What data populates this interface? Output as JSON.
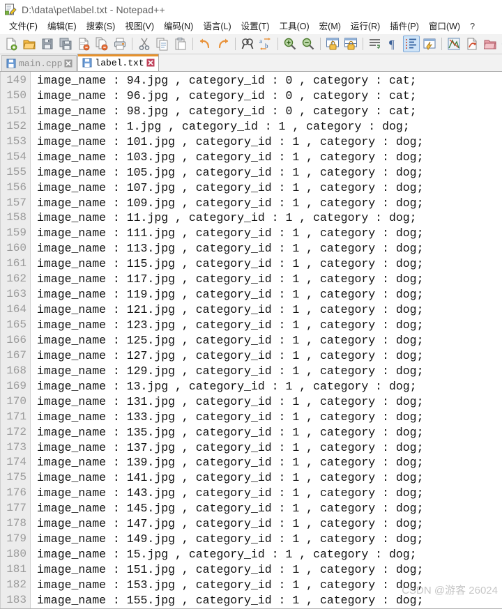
{
  "window": {
    "title": "D:\\data\\pet\\label.txt - Notepad++",
    "icon": "notepad-plus-plus-icon"
  },
  "menubar": {
    "items": [
      {
        "label": "文件(F)"
      },
      {
        "label": "编辑(E)"
      },
      {
        "label": "搜索(S)"
      },
      {
        "label": "视图(V)"
      },
      {
        "label": "编码(N)"
      },
      {
        "label": "语言(L)"
      },
      {
        "label": "设置(T)"
      },
      {
        "label": "工具(O)"
      },
      {
        "label": "宏(M)"
      },
      {
        "label": "运行(R)"
      },
      {
        "label": "插件(P)"
      },
      {
        "label": "窗口(W)"
      },
      {
        "label": "?"
      }
    ]
  },
  "toolbar": {
    "buttons": [
      {
        "name": "new-file-icon",
        "group": 1
      },
      {
        "name": "open-file-icon",
        "group": 1
      },
      {
        "name": "save-icon",
        "group": 1
      },
      {
        "name": "save-all-icon",
        "group": 1
      },
      {
        "name": "close-file-icon",
        "group": 1
      },
      {
        "name": "close-all-files-icon",
        "group": 1
      },
      {
        "name": "print-icon",
        "group": 1
      },
      {
        "name": "cut-icon",
        "group": 2
      },
      {
        "name": "copy-icon",
        "group": 2
      },
      {
        "name": "paste-icon",
        "group": 2
      },
      {
        "name": "undo-icon",
        "group": 3
      },
      {
        "name": "redo-icon",
        "group": 3
      },
      {
        "name": "find-icon",
        "group": 4
      },
      {
        "name": "replace-icon",
        "group": 4
      },
      {
        "name": "zoom-in-icon",
        "group": 5
      },
      {
        "name": "zoom-out-icon",
        "group": 5
      },
      {
        "name": "sync-vertical-scroll-icon",
        "group": 6
      },
      {
        "name": "sync-horizontal-scroll-icon",
        "group": 6
      },
      {
        "name": "word-wrap-icon",
        "group": 7
      },
      {
        "name": "show-all-characters-icon",
        "group": 7
      },
      {
        "name": "show-indent-guide-icon",
        "group": 7,
        "active": true
      },
      {
        "name": "show-ui-elements-icon",
        "group": 7
      },
      {
        "name": "show-wrap-symbol-icon",
        "group": 8
      },
      {
        "name": "user-defined-language-icon",
        "group": 8
      },
      {
        "name": "document-map-icon",
        "group": 8
      },
      {
        "name": "function-list-icon",
        "group": 8
      },
      {
        "name": "start-recording-macro-icon",
        "group": 9
      },
      {
        "name": "stop-recording-macro-icon",
        "group": 9
      }
    ]
  },
  "tabs": [
    {
      "label": "main.cpp",
      "active": false,
      "icon": "save-blue-icon",
      "close_icon": "close-icon"
    },
    {
      "label": "label.txt",
      "active": true,
      "icon": "save-blue-icon",
      "close_icon": "close-icon"
    }
  ],
  "editor": {
    "first_line_number": 149,
    "lines": [
      {
        "n": 149,
        "text": "image_name : 94.jpg , category_id : 0 , category : cat;"
      },
      {
        "n": 150,
        "text": "image_name : 96.jpg , category_id : 0 , category : cat;"
      },
      {
        "n": 151,
        "text": "image_name : 98.jpg , category_id : 0 , category : cat;"
      },
      {
        "n": 152,
        "text": "image_name : 1.jpg , category_id : 1 , category : dog;"
      },
      {
        "n": 153,
        "text": "image_name : 101.jpg , category_id : 1 , category : dog;"
      },
      {
        "n": 154,
        "text": "image_name : 103.jpg , category_id : 1 , category : dog;"
      },
      {
        "n": 155,
        "text": "image_name : 105.jpg , category_id : 1 , category : dog;"
      },
      {
        "n": 156,
        "text": "image_name : 107.jpg , category_id : 1 , category : dog;"
      },
      {
        "n": 157,
        "text": "image_name : 109.jpg , category_id : 1 , category : dog;"
      },
      {
        "n": 158,
        "text": "image_name : 11.jpg , category_id : 1 , category : dog;"
      },
      {
        "n": 159,
        "text": "image_name : 111.jpg , category_id : 1 , category : dog;"
      },
      {
        "n": 160,
        "text": "image_name : 113.jpg , category_id : 1 , category : dog;"
      },
      {
        "n": 161,
        "text": "image_name : 115.jpg , category_id : 1 , category : dog;"
      },
      {
        "n": 162,
        "text": "image_name : 117.jpg , category_id : 1 , category : dog;"
      },
      {
        "n": 163,
        "text": "image_name : 119.jpg , category_id : 1 , category : dog;"
      },
      {
        "n": 164,
        "text": "image_name : 121.jpg , category_id : 1 , category : dog;"
      },
      {
        "n": 165,
        "text": "image_name : 123.jpg , category_id : 1 , category : dog;"
      },
      {
        "n": 166,
        "text": "image_name : 125.jpg , category_id : 1 , category : dog;"
      },
      {
        "n": 167,
        "text": "image_name : 127.jpg , category_id : 1 , category : dog;"
      },
      {
        "n": 168,
        "text": "image_name : 129.jpg , category_id : 1 , category : dog;"
      },
      {
        "n": 169,
        "text": "image_name : 13.jpg , category_id : 1 , category : dog;"
      },
      {
        "n": 170,
        "text": "image_name : 131.jpg , category_id : 1 , category : dog;"
      },
      {
        "n": 171,
        "text": "image_name : 133.jpg , category_id : 1 , category : dog;"
      },
      {
        "n": 172,
        "text": "image_name : 135.jpg , category_id : 1 , category : dog;"
      },
      {
        "n": 173,
        "text": "image_name : 137.jpg , category_id : 1 , category : dog;"
      },
      {
        "n": 174,
        "text": "image_name : 139.jpg , category_id : 1 , category : dog;"
      },
      {
        "n": 175,
        "text": "image_name : 141.jpg , category_id : 1 , category : dog;"
      },
      {
        "n": 176,
        "text": "image_name : 143.jpg , category_id : 1 , category : dog;"
      },
      {
        "n": 177,
        "text": "image_name : 145.jpg , category_id : 1 , category : dog;"
      },
      {
        "n": 178,
        "text": "image_name : 147.jpg , category_id : 1 , category : dog;"
      },
      {
        "n": 179,
        "text": "image_name : 149.jpg , category_id : 1 , category : dog;"
      },
      {
        "n": 180,
        "text": "image_name : 15.jpg , category_id : 1 , category : dog;"
      },
      {
        "n": 181,
        "text": "image_name : 151.jpg , category_id : 1 , category : dog;"
      },
      {
        "n": 182,
        "text": "image_name : 153.jpg , category_id : 1 , category : dog;"
      },
      {
        "n": 183,
        "text": "image_name : 155.jpg , category_id : 1 , category : dog;"
      }
    ]
  },
  "watermark": {
    "text": "CSDN @游客 26024"
  },
  "colors": {
    "tab_active_accent": "#e8922c",
    "gutter_bg": "#ececec",
    "gutter_text": "#9a9a9a",
    "toolbar_bg": "#f2f2f2",
    "editor_text": "#101010",
    "title_text": "#5f5f5f"
  }
}
